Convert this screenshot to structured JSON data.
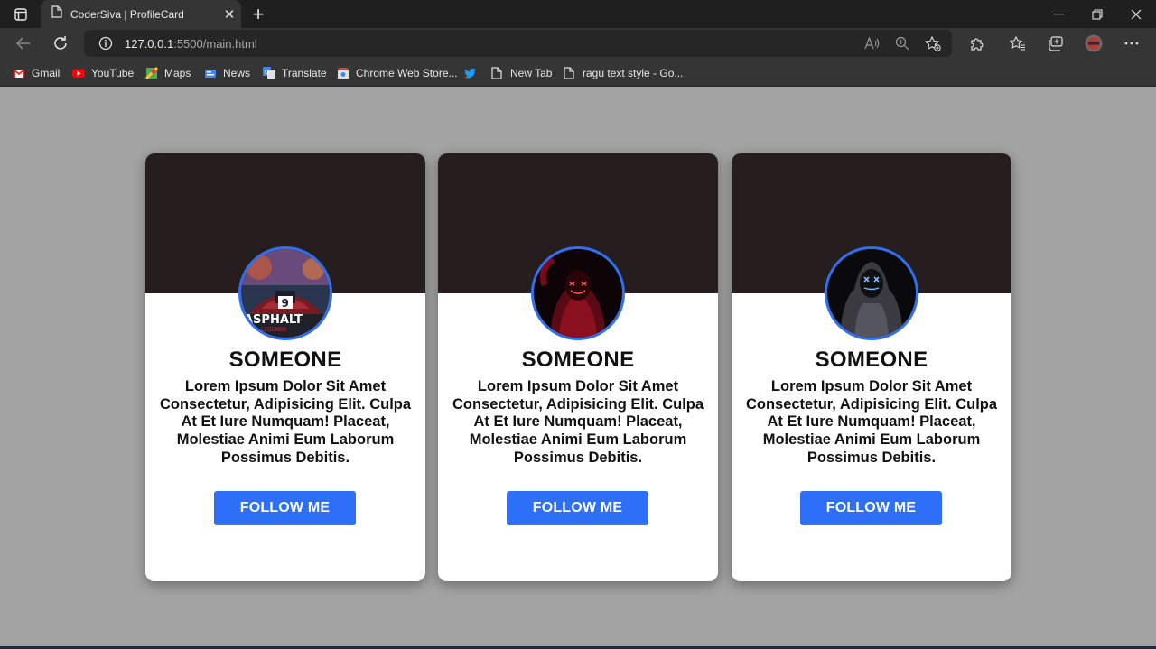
{
  "browser": {
    "tab_title": "CoderSiva | ProfileCard",
    "url_host": "127.0.0.1",
    "url_rest": ":5500/main.html",
    "bookmarks": [
      {
        "label": "Gmail",
        "icon": "gmail-icon"
      },
      {
        "label": "YouTube",
        "icon": "youtube-icon"
      },
      {
        "label": "Maps",
        "icon": "maps-icon"
      },
      {
        "label": "News",
        "icon": "news-icon"
      },
      {
        "label": "Translate",
        "icon": "translate-icon"
      },
      {
        "label": "Chrome Web Store...",
        "icon": "web-store-icon"
      },
      {
        "label": "",
        "icon": "twitter-icon"
      },
      {
        "label": "New Tab",
        "icon": "page-icon"
      },
      {
        "label": "ragu text style - Go...",
        "icon": "page-icon"
      }
    ]
  },
  "colors": {
    "page_bg": "#a3a3a3",
    "card_header": "#261e1e",
    "accent": "#2d6ff7"
  },
  "cards": [
    {
      "name": "SOMEONE",
      "avatar": "asphalt-game-avatar",
      "description": "Lorem Ipsum Dolor Sit Amet Consectetur, Adipisicing Elit. Culpa At Et Iure Numquam! Placeat, Molestiae Animi Eum Laborum Possimus Debitis.",
      "button": "FOLLOW ME"
    },
    {
      "name": "SOMEONE",
      "avatar": "neon-mask-avatar",
      "description": "Lorem Ipsum Dolor Sit Amet Consectetur, Adipisicing Elit. Culpa At Et Iure Numquam! Placeat, Molestiae Animi Eum Laborum Possimus Debitis.",
      "button": "FOLLOW ME"
    },
    {
      "name": "SOMEONE",
      "avatar": "hooded-figure-avatar",
      "description": "Lorem Ipsum Dolor Sit Amet Consectetur, Adipisicing Elit. Culpa At Et Iure Numquam! Placeat, Molestiae Animi Eum Laborum Possimus Debitis.",
      "button": "FOLLOW ME"
    }
  ]
}
